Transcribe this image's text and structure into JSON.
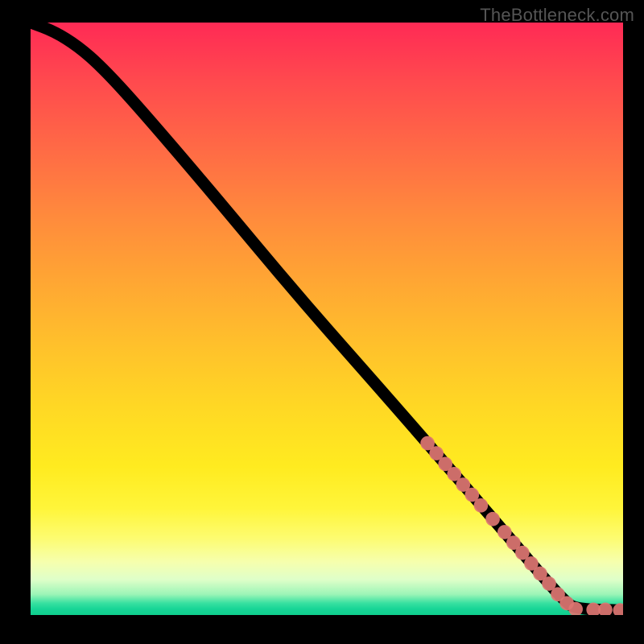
{
  "watermark": "TheBottleneck.com",
  "chart_data": {
    "type": "line",
    "title": "",
    "xlabel": "",
    "ylabel": "",
    "xlim": [
      0,
      100
    ],
    "ylim": [
      0,
      100
    ],
    "grid": false,
    "legend": false,
    "curve": [
      {
        "x": 0,
        "y": 100
      },
      {
        "x": 4,
        "y": 98.5
      },
      {
        "x": 8,
        "y": 96
      },
      {
        "x": 12,
        "y": 92.5
      },
      {
        "x": 18,
        "y": 86
      },
      {
        "x": 30,
        "y": 72
      },
      {
        "x": 45,
        "y": 54
      },
      {
        "x": 60,
        "y": 37
      },
      {
        "x": 70,
        "y": 25.5
      },
      {
        "x": 80,
        "y": 14
      },
      {
        "x": 86,
        "y": 7
      },
      {
        "x": 90,
        "y": 2.5
      },
      {
        "x": 92,
        "y": 1
      },
      {
        "x": 100,
        "y": 0.8
      }
    ],
    "markers": [
      {
        "x": 67,
        "y": 29
      },
      {
        "x": 68.5,
        "y": 27.3
      },
      {
        "x": 70,
        "y": 25.5
      },
      {
        "x": 71.5,
        "y": 23.8
      },
      {
        "x": 73,
        "y": 22
      },
      {
        "x": 74.5,
        "y": 20.3
      },
      {
        "x": 76,
        "y": 18.5
      },
      {
        "x": 78,
        "y": 16.2
      },
      {
        "x": 80,
        "y": 14
      },
      {
        "x": 81.5,
        "y": 12.2
      },
      {
        "x": 83,
        "y": 10.5
      },
      {
        "x": 84.5,
        "y": 8.7
      },
      {
        "x": 86,
        "y": 7
      },
      {
        "x": 87.5,
        "y": 5.3
      },
      {
        "x": 89,
        "y": 3.5
      },
      {
        "x": 90.5,
        "y": 2
      },
      {
        "x": 92,
        "y": 1
      },
      {
        "x": 95,
        "y": 0.9
      },
      {
        "x": 97,
        "y": 0.9
      },
      {
        "x": 99.5,
        "y": 0.8
      }
    ],
    "marker_radius_pct": 1.2
  }
}
